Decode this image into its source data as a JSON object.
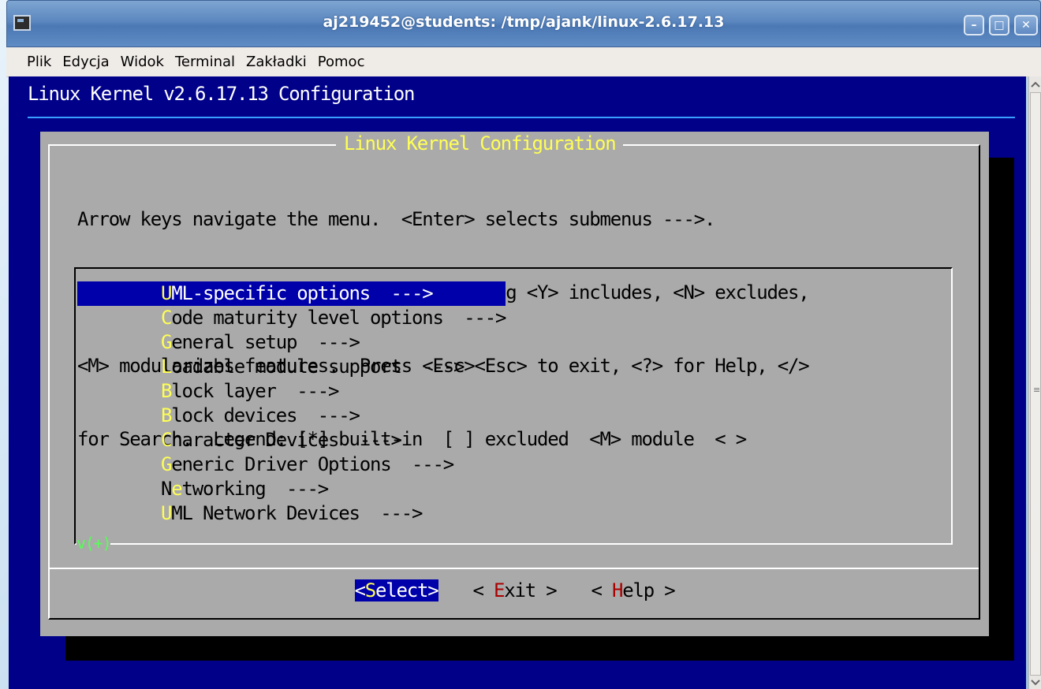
{
  "window": {
    "title": "aj219452@students: /tmp/ajank/linux-2.6.17.13",
    "buttons": [
      "minimize",
      "maximize",
      "close"
    ]
  },
  "menubar": {
    "items": [
      "Plik",
      "Edycja",
      "Widok",
      "Terminal",
      "Zakładki",
      "Pomoc"
    ]
  },
  "terminal": {
    "header": "Linux Kernel v2.6.17.13 Configuration",
    "colors": {
      "background": "#000089",
      "dialog": "#aaaaaa",
      "hotkey": "#ffff55",
      "highlight": "#0000aa"
    }
  },
  "dialog": {
    "title": "Linux Kernel Configuration",
    "help_lines": [
      "Arrow keys navigate the menu.  <Enter> selects submenus --->.",
      "Highlighted letters are hotkeys.  Pressing <Y> includes, <N> excludes,",
      "<M> modularizes features.  Press <Esc><Esc> to exit, <?> for Help, </>",
      "for Search.  Legend: [*] built-in  [ ] excluded  <M> module  < >"
    ],
    "menu_items": [
      {
        "hotkey": "U",
        "rest": "ML-specific options  --->",
        "selected": true
      },
      {
        "hotkey": "C",
        "rest": "ode maturity level options  --->",
        "selected": false
      },
      {
        "hotkey": "G",
        "rest": "eneral setup  --->",
        "selected": false
      },
      {
        "hotkey": "L",
        "rest": "oadable module support  --->",
        "selected": false
      },
      {
        "hotkey": "B",
        "rest": "lock layer  --->",
        "selected": false
      },
      {
        "hotkey": "B",
        "rest": "lock devices  --->",
        "selected": false
      },
      {
        "hotkey": "C",
        "rest": "haracter Devices  --->",
        "selected": false
      },
      {
        "hotkey": "G",
        "rest": "eneric Driver Options  --->",
        "selected": false
      },
      {
        "prefix": "N",
        "hotkey": "e",
        "rest": "tworking  --->",
        "selected": false
      },
      {
        "hotkey": "U",
        "rest": "ML Network Devices  --->",
        "selected": false
      }
    ],
    "more_indicator": "v(+)",
    "buttons": [
      {
        "open": "<",
        "hotkey": "S",
        "rest": "elect",
        "close": ">",
        "selected": true
      },
      {
        "open": "< ",
        "hotkey": "E",
        "rest": "xit",
        "close": " >",
        "selected": false
      },
      {
        "open": "< ",
        "hotkey": "H",
        "rest": "elp",
        "close": " >",
        "selected": false
      }
    ]
  }
}
